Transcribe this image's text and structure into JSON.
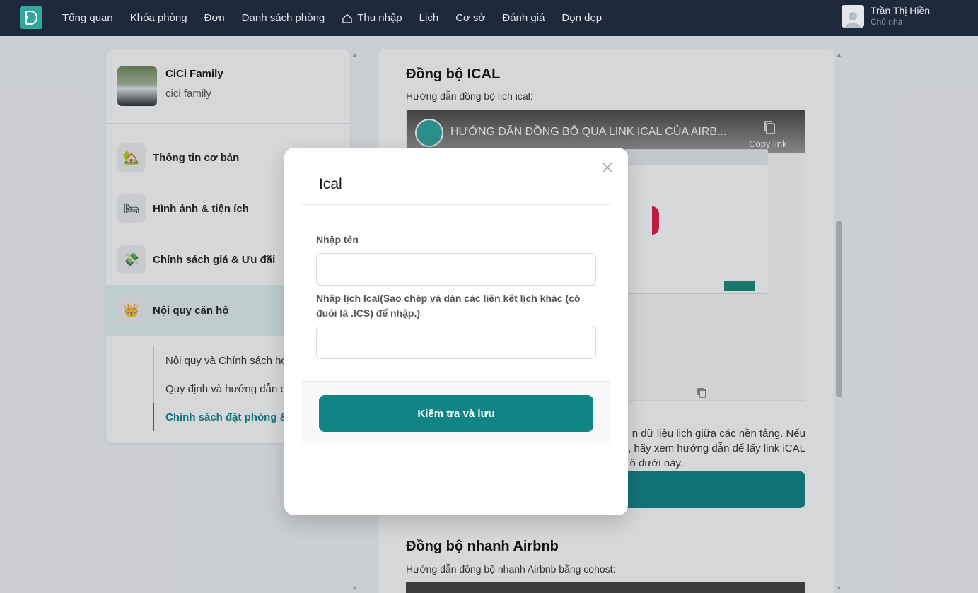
{
  "nav": {
    "items": [
      "Tổng quan",
      "Khóa phòng",
      "Đơn",
      "Danh sách phòng",
      "Thu nhập",
      "Lịch",
      "Cơ sở",
      "Đánh giá",
      "Dọn dẹp"
    ]
  },
  "user": {
    "name": "Trần Thị Hiền",
    "role": "Chủ nhà"
  },
  "property": {
    "name": "CiCi Family",
    "subtitle": "cici family"
  },
  "sidebar": {
    "items": [
      {
        "label": "Thông tin cơ bản",
        "icon": "house-tree-icon"
      },
      {
        "label": "Hình ảnh & tiện ích",
        "icon": "bed-icon"
      },
      {
        "label": "Chính sách giá & Ưu đãi",
        "icon": "money-icon"
      },
      {
        "label": "Nội quy căn hộ",
        "icon": "crown-icon"
      }
    ],
    "subitems": [
      "Nội quy và Chính sách hoạ",
      "Quy định và hướng dẫn ch",
      "Chính sách đặt phòng & Đ"
    ],
    "active_subitem": 2
  },
  "main": {
    "ical_title": "Đồng bộ ICAL",
    "ical_guide": "Hướng dẫn đồng bộ lịch ical:",
    "video_title": "HƯỚNG DẪN ĐỒNG BỘ QUA LINK ICAL CỦA AIRB...",
    "video_copy": "Copy link",
    "paragraph_lines": [
      "n dữ liệu lịch giữa các nền tảng. Nếu",
      ", hãy xem hướng dẫn để lấy link iCAL",
      "o ô dưới này."
    ],
    "airbnb_title": "Đồng bộ nhanh Airbnb",
    "airbnb_guide": "Hướng dẫn đồng bộ nhanh Airbnb bằng cohost:"
  },
  "modal": {
    "title": "Ical",
    "name_label": "Nhập tên",
    "name_value": "",
    "ical_label": "Nhập lịch Ical(Sao chép và dán các liên kết lịch khác (có đuôi là .ICS) để nhập.)",
    "ical_value": "",
    "submit_label": "Kiểm tra và lưu"
  },
  "colors": {
    "accent": "#0f8585",
    "navbar": "#1e2a3b",
    "active_bg": "#e3f2ef"
  }
}
